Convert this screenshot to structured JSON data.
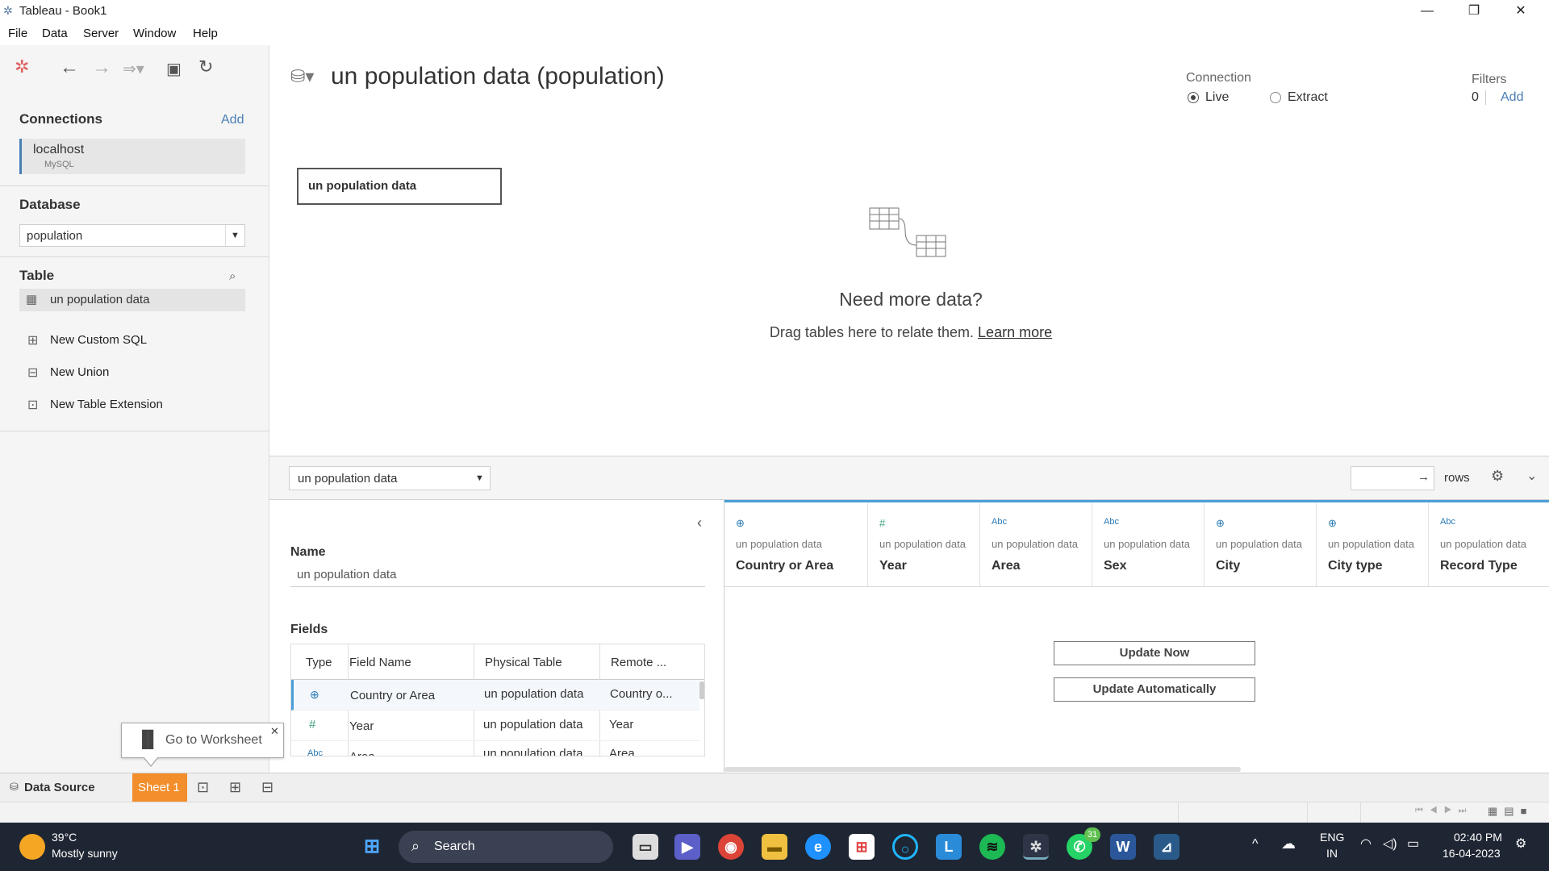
{
  "window": {
    "title": "Tableau - Book1"
  },
  "menu": [
    "File",
    "Data",
    "Server",
    "Window",
    "Help"
  ],
  "left": {
    "connections_label": "Connections",
    "add_label": "Add",
    "connection": {
      "name": "localhost",
      "type": "MySQL"
    },
    "database_label": "Database",
    "database_value": "population",
    "table_label": "Table",
    "tables": [
      "un population data"
    ],
    "links": [
      "New Custom SQL",
      "New Union",
      "New Table Extension"
    ]
  },
  "canvas": {
    "datasource_title": "un population data (population)",
    "connection_label": "Connection",
    "live_label": "Live",
    "extract_label": "Extract",
    "filters_label": "Filters",
    "filters_count": "0",
    "filters_add": "Add",
    "table_card": "un population data",
    "more_title": "Need more data?",
    "more_text": "Drag tables here to relate them.",
    "learn_more": "Learn more"
  },
  "gridbar": {
    "table_select": "un population data",
    "rows_label": "rows"
  },
  "meta": {
    "name_label": "Name",
    "name_value": "un population data",
    "fields_label": "Fields",
    "headers": [
      "Type",
      "Field Name",
      "Physical Table",
      "Remote ..."
    ],
    "rows": [
      {
        "type_icon": "globe-icon",
        "field": "Country or Area",
        "table": "un population data",
        "remote": "Country o..."
      },
      {
        "type_icon": "number-icon",
        "field": "Year",
        "table": "un population data",
        "remote": "Year"
      },
      {
        "type_icon": "string-icon",
        "field": "Area",
        "table": "un population data",
        "remote": "Area"
      }
    ]
  },
  "grid": {
    "columns": [
      {
        "icon": "globe-icon",
        "source": "un population data",
        "name": "Country or Area"
      },
      {
        "icon": "number-icon",
        "source": "un population data",
        "name": "Year"
      },
      {
        "icon": "string-icon",
        "source": "un population data",
        "name": "Area"
      },
      {
        "icon": "string-icon",
        "source": "un population data",
        "name": "Sex"
      },
      {
        "icon": "globe-icon",
        "source": "un population data",
        "name": "City"
      },
      {
        "icon": "globe-icon",
        "source": "un population data",
        "name": "City type"
      },
      {
        "icon": "string-icon",
        "source": "un population data",
        "name": "Record Type"
      }
    ],
    "update_now": "Update Now",
    "update_auto": "Update Automatically"
  },
  "tabs": {
    "data_source": "Data Source",
    "sheet": "Sheet 1",
    "tooltip": "Go to Worksheet"
  },
  "taskbar": {
    "weather_temp": "39°C",
    "weather_desc": "Mostly sunny",
    "search": "Search",
    "lang1": "ENG",
    "lang2": "IN",
    "time": "02:40 PM",
    "date": "16-04-2023",
    "whatsapp_badge": "31"
  },
  "colors": {
    "accent": "#4a7fb5",
    "sheet_tab": "#f28e2b",
    "grid_top": "#4a9fd8",
    "taskbar": "#1f2633"
  }
}
